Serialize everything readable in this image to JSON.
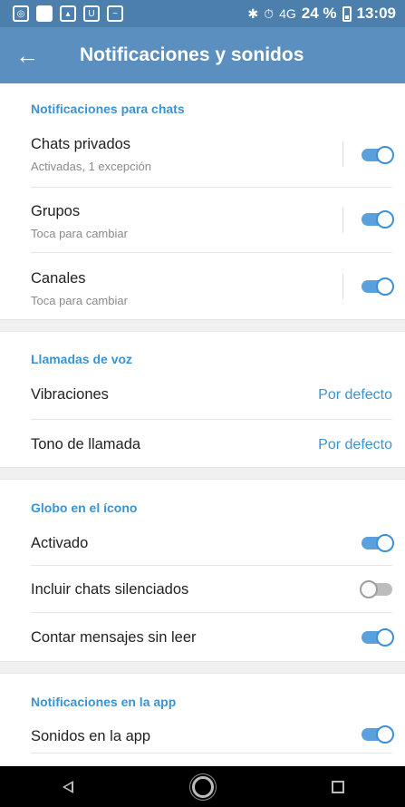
{
  "status_bar": {
    "icons": [
      "instagram-icon",
      "white-square-icon",
      "gallery-icon",
      "shield-icon",
      "chart-icon"
    ],
    "bluetooth": "✱",
    "alarm": "⏱",
    "network": "4G",
    "battery_percent": "24 %",
    "time": "13:09"
  },
  "app_bar": {
    "back_icon": "←",
    "title": "Notificaciones y sonidos"
  },
  "sections": {
    "chats": {
      "header": "Notificaciones para chats",
      "private": {
        "title": "Chats privados",
        "subtitle": "Activadas, 1 excepción",
        "enabled": true
      },
      "groups": {
        "title": "Grupos",
        "subtitle": "Toca para cambiar",
        "enabled": true
      },
      "channels": {
        "title": "Canales",
        "subtitle": "Toca para cambiar",
        "enabled": true
      }
    },
    "calls": {
      "header": "Llamadas de voz",
      "vibrations": {
        "title": "Vibraciones",
        "value": "Por defecto"
      },
      "ringtone": {
        "title": "Tono de llamada",
        "value": "Por defecto"
      }
    },
    "badge": {
      "header": "Globo en el ícono",
      "enabled": {
        "title": "Activado",
        "enabled": true
      },
      "include_muted": {
        "title": "Incluir chats silenciados",
        "enabled": false
      },
      "count_unread": {
        "title": "Contar mensajes sin leer",
        "enabled": true
      }
    },
    "in_app": {
      "header": "Notificaciones en la app",
      "sounds": {
        "title": "Sonidos en la app",
        "enabled": true
      }
    }
  },
  "colors": {
    "status_bar": "#4c7fac",
    "app_bar": "#5b8fc0",
    "accent": "#3a93d2",
    "toggle_on": "#5aa0dc",
    "toggle_off": "#bdbdbd"
  },
  "nav_bar": {
    "buttons": [
      "back-triangle-icon",
      "home-circle-icon",
      "recents-square-icon"
    ]
  }
}
